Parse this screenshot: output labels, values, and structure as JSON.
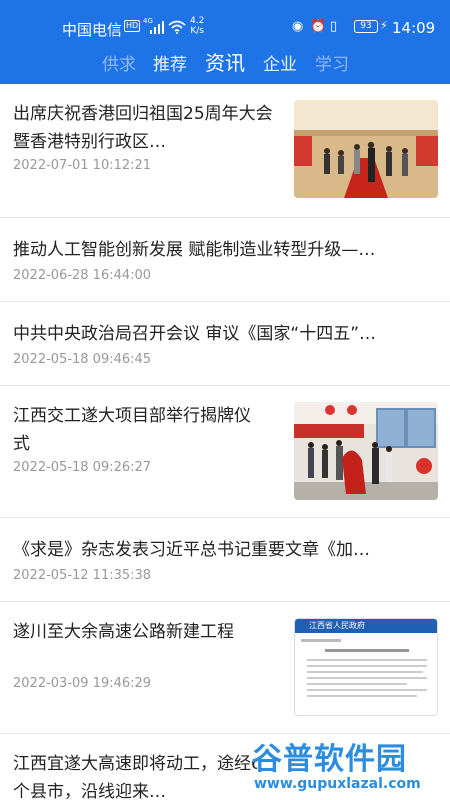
{
  "status_bar": {
    "carrier": "中国电信",
    "hd_badge": "HD",
    "network": "4G",
    "speed_value": "4.2",
    "speed_unit": "K/s",
    "battery": "93",
    "time": "14:09"
  },
  "tabs": [
    {
      "label": "供求"
    },
    {
      "label": "推荐"
    },
    {
      "label": "资讯"
    },
    {
      "label": "企业"
    },
    {
      "label": "学习"
    }
  ],
  "active_tab": "资讯",
  "articles": [
    {
      "title": "出席庆祝香港回归祖国25周年大会暨香港特别行政区…",
      "date": "2022-07-01 10:12:21",
      "thumbnail": "ceremony-photo"
    },
    {
      "title": "推动人工智能创新发展 赋能制造业转型升级—…",
      "date": "2022-06-28 16:44:00"
    },
    {
      "title": "中共中央政治局召开会议 审议《国家“十四五”…",
      "date": "2022-05-18 09:46:45"
    },
    {
      "title": "江西交工遂大项目部举行揭牌仪式",
      "date": "2022-05-18 09:26:27",
      "thumbnail": "plaque-unveiling-photo"
    },
    {
      "title": "《求是》杂志发表习近平总书记重要文章《加…",
      "date": "2022-05-12 11:35:38"
    },
    {
      "title": "遂川至大余高速公路新建工程",
      "date": "2022-03-09 19:46:29",
      "thumbnail": "document-screenshot"
    },
    {
      "title": "江西宜遂大高速即将动工，途经6个县市，沿线迎来…",
      "date": ""
    }
  ],
  "thumb_texts": {
    "doc_header": "江西省人民政府"
  },
  "watermark": {
    "name": "谷普软件园",
    "url": "www.gupuxlazal.com"
  },
  "colors": {
    "header_blue": "#1e74e6",
    "date_gray": "#999999",
    "divider": "#e7e7e7"
  }
}
